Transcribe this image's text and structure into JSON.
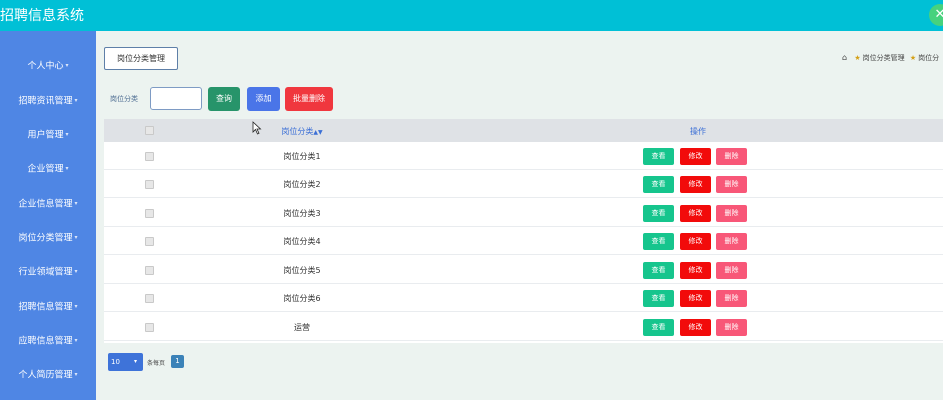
{
  "app": {
    "title": "招聘信息系统",
    "close_icon": "close-icon"
  },
  "sidebar": {
    "items": [
      {
        "label": "个人中心"
      },
      {
        "label": "招聘资讯管理"
      },
      {
        "label": "用户管理"
      },
      {
        "label": "企业管理"
      },
      {
        "label": "企业信息管理"
      },
      {
        "label": "岗位分类管理"
      },
      {
        "label": "行业领域管理"
      },
      {
        "label": "招聘信息管理"
      },
      {
        "label": "应聘信息管理"
      },
      {
        "label": "个人简历管理"
      }
    ]
  },
  "page": {
    "title": "岗位分类管理",
    "breadcrumb": [
      "岗位分类管理",
      "岗位分"
    ]
  },
  "search": {
    "label": "岗位分类",
    "value": "",
    "query_label": "查询",
    "add_label": "添加",
    "bulk_delete_label": "批量删除"
  },
  "table": {
    "columns": [
      "岗位分类",
      "操作"
    ],
    "sort_icon": "sort-icon",
    "rows": [
      {
        "name": "岗位分类1"
      },
      {
        "name": "岗位分类2"
      },
      {
        "name": "岗位分类3"
      },
      {
        "name": "岗位分类4"
      },
      {
        "name": "岗位分类5"
      },
      {
        "name": "岗位分类6"
      },
      {
        "name": "运营"
      }
    ],
    "actions": {
      "view": "查看",
      "edit": "修改",
      "delete": "删除"
    }
  },
  "pager": {
    "page_size": "10",
    "per_page_label": "条每页",
    "current_page": "1"
  },
  "colors": {
    "topbar": "#00c0d6",
    "sidebar": "#4f86e4",
    "view": "#16c58d",
    "edit": "#f20b0b",
    "delete": "#f85778",
    "query": "#27946a",
    "add": "#4a75e8",
    "bulk_delete": "#f0373e"
  }
}
